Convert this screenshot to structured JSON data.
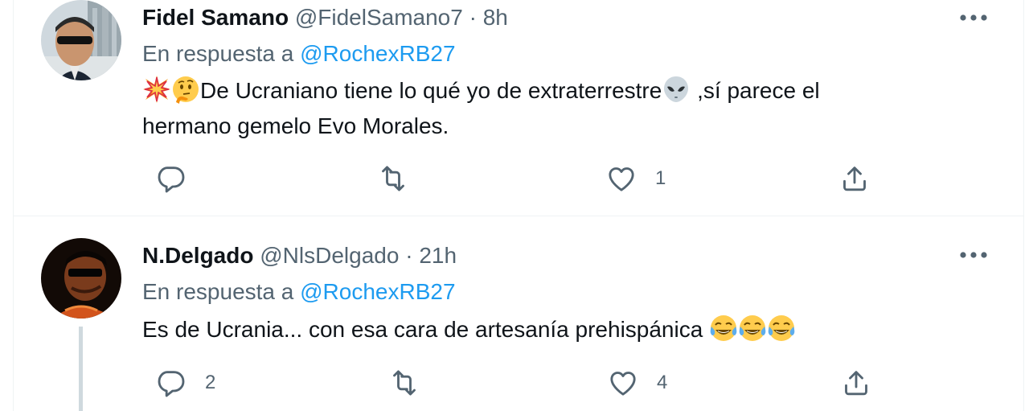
{
  "tweets": [
    {
      "display_name": "Fidel Samano",
      "handle": "@FidelSamano7",
      "separator": "·",
      "time": "8h",
      "reply_prefix": "En respuesta a",
      "reply_to": "@RochexRB27",
      "text_line1_a": "De Ucraniano tiene lo qué yo de extraterrestre",
      "text_line1_b": " ,sí parece el",
      "text_line2": "hermano gemelo Evo Morales.",
      "emojis": [
        "collision-emoji",
        "thinking-face-emoji",
        "alien-emoji"
      ],
      "reply_count": "",
      "retweet_count": "",
      "like_count": "1"
    },
    {
      "display_name": "N.Delgado",
      "handle": "@NlsDelgado",
      "separator": "·",
      "time": "21h",
      "reply_prefix": "En respuesta a",
      "reply_to": "@RochexRB27",
      "text": "Es de Ucrania... con esa cara de artesanía prehispánica ",
      "emojis": [
        "tears-of-joy-emoji",
        "tears-of-joy-emoji",
        "tears-of-joy-emoji"
      ],
      "reply_count": "2",
      "retweet_count": "",
      "like_count": "4"
    }
  ],
  "colors": {
    "text_primary": "#0f1419",
    "text_secondary": "#536471",
    "link": "#1d9bf0",
    "border": "#eff3f4",
    "thread_line": "#cfd9de"
  }
}
